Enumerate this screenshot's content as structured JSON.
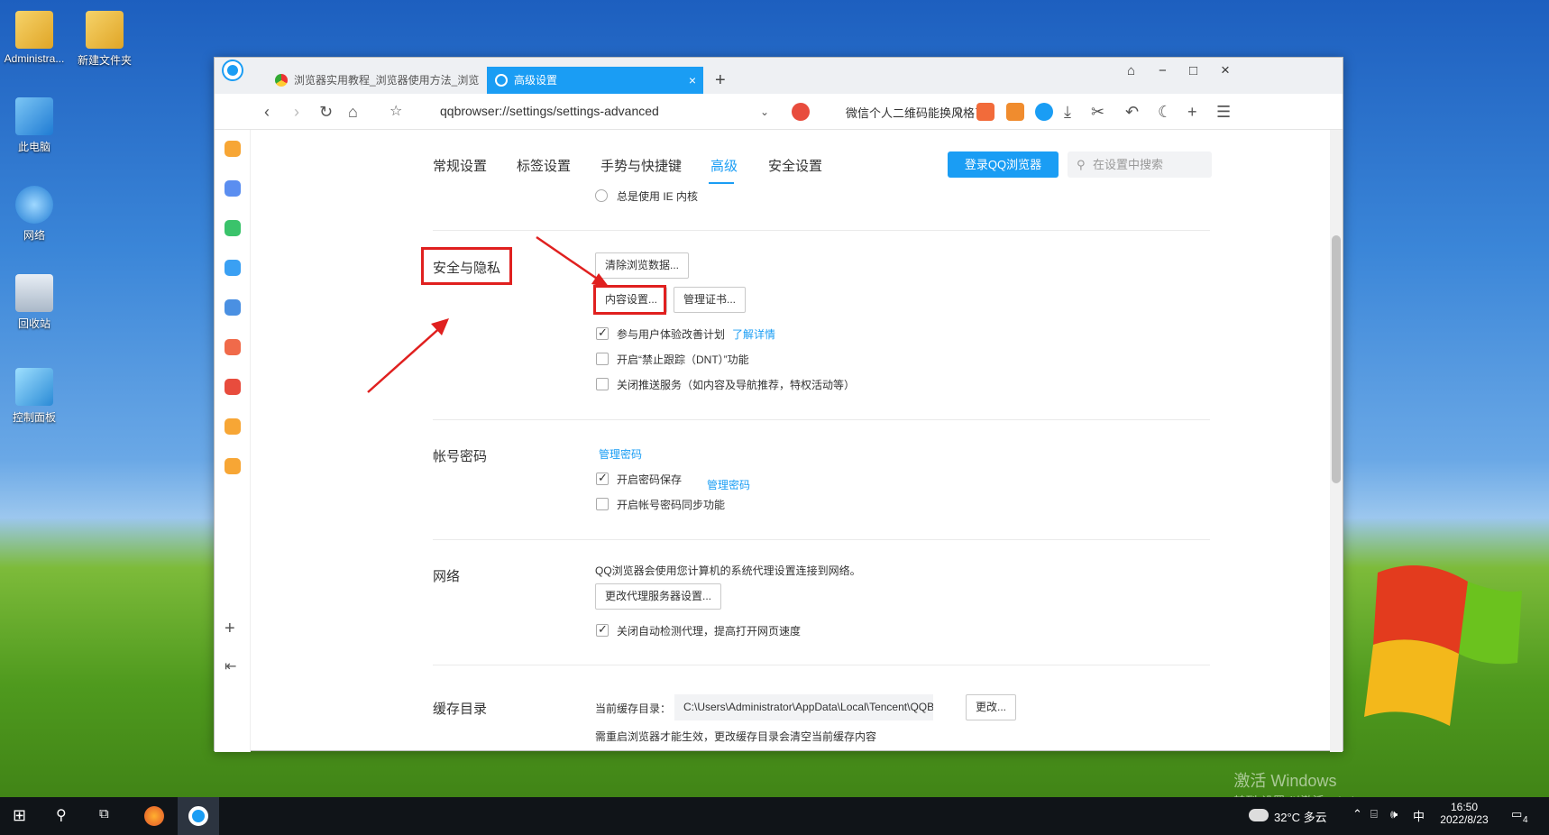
{
  "desktop": {
    "icons": [
      {
        "label": "Administra...",
        "icon": "user-folder-icon"
      },
      {
        "label": "新建文件夹",
        "icon": "folder-icon"
      },
      {
        "label": "此电脑",
        "icon": "computer-icon"
      },
      {
        "label": "网络",
        "icon": "network-icon"
      },
      {
        "label": "回收站",
        "icon": "recycle-bin-icon"
      },
      {
        "label": "控制面板",
        "icon": "control-panel-icon"
      }
    ],
    "watermark_line1": "激活 Windows",
    "watermark_line2": "转到\"设置\"以激活 Windows。"
  },
  "browser": {
    "tabs": [
      {
        "label": "浏览器实用教程_浏览器使用方法_浏览",
        "active": false
      },
      {
        "label": "高级设置",
        "active": true
      }
    ],
    "tab_close": "×",
    "new_tab": "+",
    "window_controls": {
      "pin": "⌂",
      "minimize": "−",
      "maximize": "□",
      "close": "×"
    },
    "url": "qqbrowser://settings/settings-advanced",
    "search_text": "微信个人二维码能换风格了"
  },
  "settings": {
    "nav": [
      {
        "label": "常规设置",
        "active": false
      },
      {
        "label": "标签设置",
        "active": false
      },
      {
        "label": "手势与快捷键",
        "active": false
      },
      {
        "label": "高级",
        "active": true
      },
      {
        "label": "安全设置",
        "active": false
      }
    ],
    "login_button": "登录QQ浏览器",
    "search_placeholder": "在设置中搜索",
    "ie_core": {
      "label": "总是使用 IE 内核",
      "checked": false
    },
    "privacy": {
      "title": "安全与隐私",
      "clear_data_button": "清除浏览数据...",
      "content_settings_button": "内容设置...",
      "manage_cert_button": "管理证书...",
      "options": [
        {
          "label": "参与用户体验改善计划",
          "checked": true,
          "link": "了解详情"
        },
        {
          "label": "开启“禁止跟踪（DNT）”功能",
          "checked": false
        },
        {
          "label": "关闭推送服务（如内容及导航推荐，特权活动等）",
          "checked": false
        }
      ]
    },
    "account": {
      "title": "帐号密码",
      "manage_link": "管理密码",
      "options": [
        {
          "label": "开启密码保存",
          "checked": true,
          "link": "管理密码"
        },
        {
          "label": "开启帐号密码同步功能",
          "checked": false
        }
      ]
    },
    "network": {
      "title": "网络",
      "description": "QQ浏览器会使用您计算机的系统代理设置连接到网络。",
      "proxy_button": "更改代理服务器设置...",
      "options": [
        {
          "label": "关闭自动检测代理，提高打开网页速度",
          "checked": true
        }
      ]
    },
    "cache": {
      "title": "缓存目录",
      "current_label": "当前缓存目录：",
      "path": "C:\\Users\\Administrator\\AppData\\Local\\Tencent\\QQBrowser",
      "change_button": "更改...",
      "note": "需重启浏览器才能生效，更改缓存目录会清空当前缓存内容"
    }
  },
  "taskbar": {
    "weather": "32°C 多云",
    "ime": "中",
    "time": "16:50",
    "date": "2022/8/23",
    "notification_count": "4"
  },
  "colors": {
    "accent": "#1a9df4",
    "annotation_red": "#e0201f"
  }
}
